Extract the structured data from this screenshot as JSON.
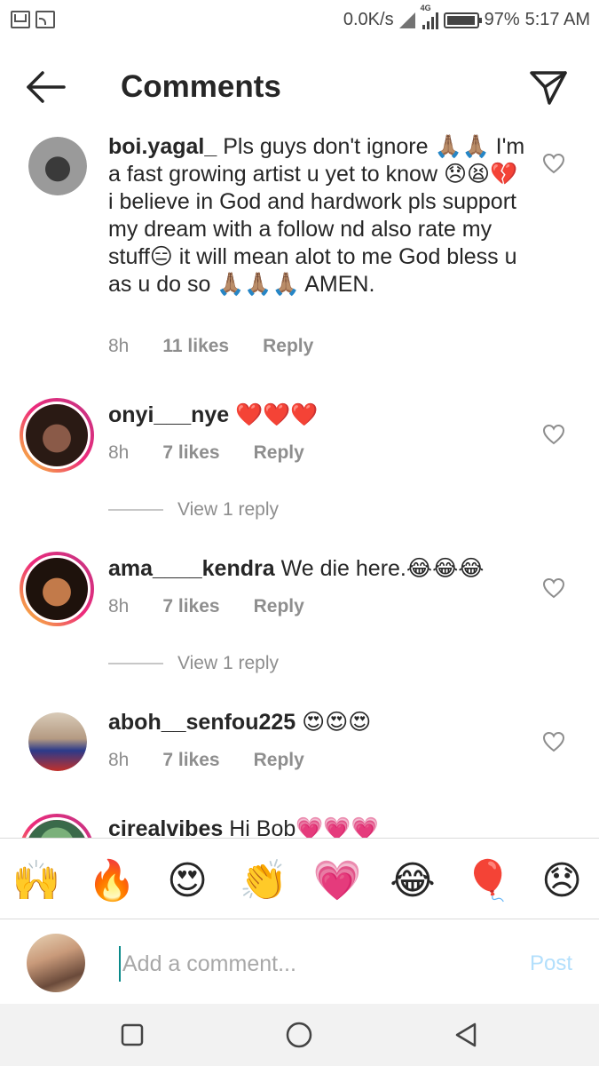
{
  "status_bar": {
    "speed": "0.0K/s",
    "network": "4G",
    "battery": "97%",
    "battery_level": 0.97,
    "time": "5:17 AM"
  },
  "header": {
    "title": "Comments",
    "back_icon": "arrow-left-icon",
    "send_icon": "paper-plane-icon"
  },
  "comments": [
    {
      "username": "boi.yagal_",
      "text": "Pls guys don't ignore 🙏🏽🙏🏽 I'm a fast growing artist u yet to know 😞😫💔 i believe in God and hardwork pls support my dream with a follow nd also rate my stuff😑 it will mean alot to me God bless u as u do so 🙏🏽🙏🏽🙏🏽 AMEN.",
      "time": "8h",
      "likes": "11 likes",
      "reply": "Reply",
      "avatar_color": "#8a8a8a"
    },
    {
      "username": "onyi___nye",
      "text": "❤️❤️❤️",
      "time": "8h",
      "likes": "7 likes",
      "reply": "Reply",
      "view_replies": "View 1 reply",
      "avatar_color": "#6b4a3a"
    },
    {
      "username": "ama____kendra",
      "text": "We die here.😂😂😂",
      "time": "8h",
      "likes": "7 likes",
      "reply": "Reply",
      "view_replies": "View 1 reply",
      "avatar_color": "#3a2418"
    },
    {
      "username": "aboh__senfou225",
      "text": "😍😍😍",
      "time": "8h",
      "likes": "7 likes",
      "reply": "Reply",
      "avatar_color": "#b8a898"
    },
    {
      "username": "cirealvibes",
      "text": "Hi Bob💗💗💗",
      "avatar_color": "#6a9a6a"
    }
  ],
  "emoji_bar": [
    "🙌",
    "🔥",
    "😍",
    "👏",
    "💗",
    "😂",
    "🎈",
    "😞"
  ],
  "compose": {
    "placeholder": "Add a comment...",
    "post_label": "Post"
  },
  "navbar": {
    "recents_icon": "square-icon",
    "home_icon": "circle-icon",
    "back_icon": "triangle-back-icon"
  }
}
